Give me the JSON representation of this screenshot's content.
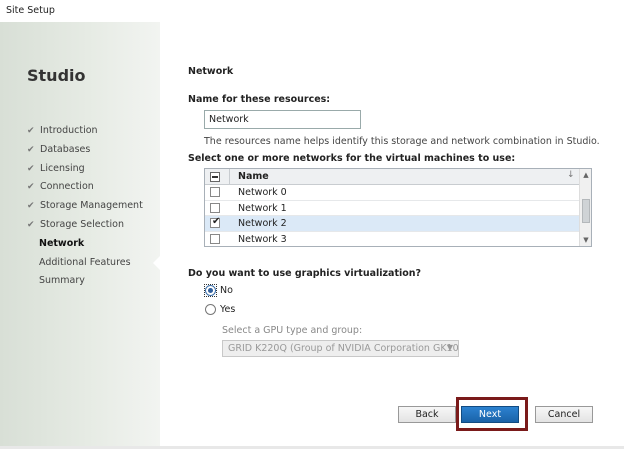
{
  "window": {
    "title": "Site Setup"
  },
  "sidebar": {
    "brand": "Studio",
    "steps": [
      {
        "label": "Introduction",
        "state": "done"
      },
      {
        "label": "Databases",
        "state": "done"
      },
      {
        "label": "Licensing",
        "state": "done"
      },
      {
        "label": "Connection",
        "state": "done"
      },
      {
        "label": "Storage Management",
        "state": "done"
      },
      {
        "label": "Storage Selection",
        "state": "done"
      },
      {
        "label": "Network",
        "state": "active"
      },
      {
        "label": "Additional Features",
        "state": "pending"
      },
      {
        "label": "Summary",
        "state": "pending"
      }
    ]
  },
  "main": {
    "heading": "Network",
    "name_label": "Name for these resources:",
    "name_value": "Network",
    "name_help": "The resources name helps identify this storage and network combination in Studio.",
    "networks_label": "Select one or more networks for the virtual machines to use:",
    "network_table": {
      "column_header": "Name",
      "rows": [
        {
          "name": "Network 0",
          "checked": false,
          "selected": false
        },
        {
          "name": "Network 1",
          "checked": false,
          "selected": false
        },
        {
          "name": "Network 2",
          "checked": true,
          "selected": true
        },
        {
          "name": "Network 3",
          "checked": false,
          "selected": false
        }
      ]
    },
    "graphics_question": "Do you want to use graphics virtualization?",
    "graphics_options": [
      {
        "label": "No",
        "selected": true
      },
      {
        "label": "Yes",
        "selected": false
      }
    ],
    "gpu_label": "Select a GPU type and group:",
    "gpu_value": "GRID K220Q (Group of NVIDIA Corporation GK10..."
  },
  "footer": {
    "back_label": "Back",
    "next_label": "Next",
    "cancel_label": "Cancel"
  },
  "colors": {
    "primary_button": "#1a62a8",
    "highlight_box": "#7a1a1a",
    "selected_row": "#dbe9f7"
  }
}
